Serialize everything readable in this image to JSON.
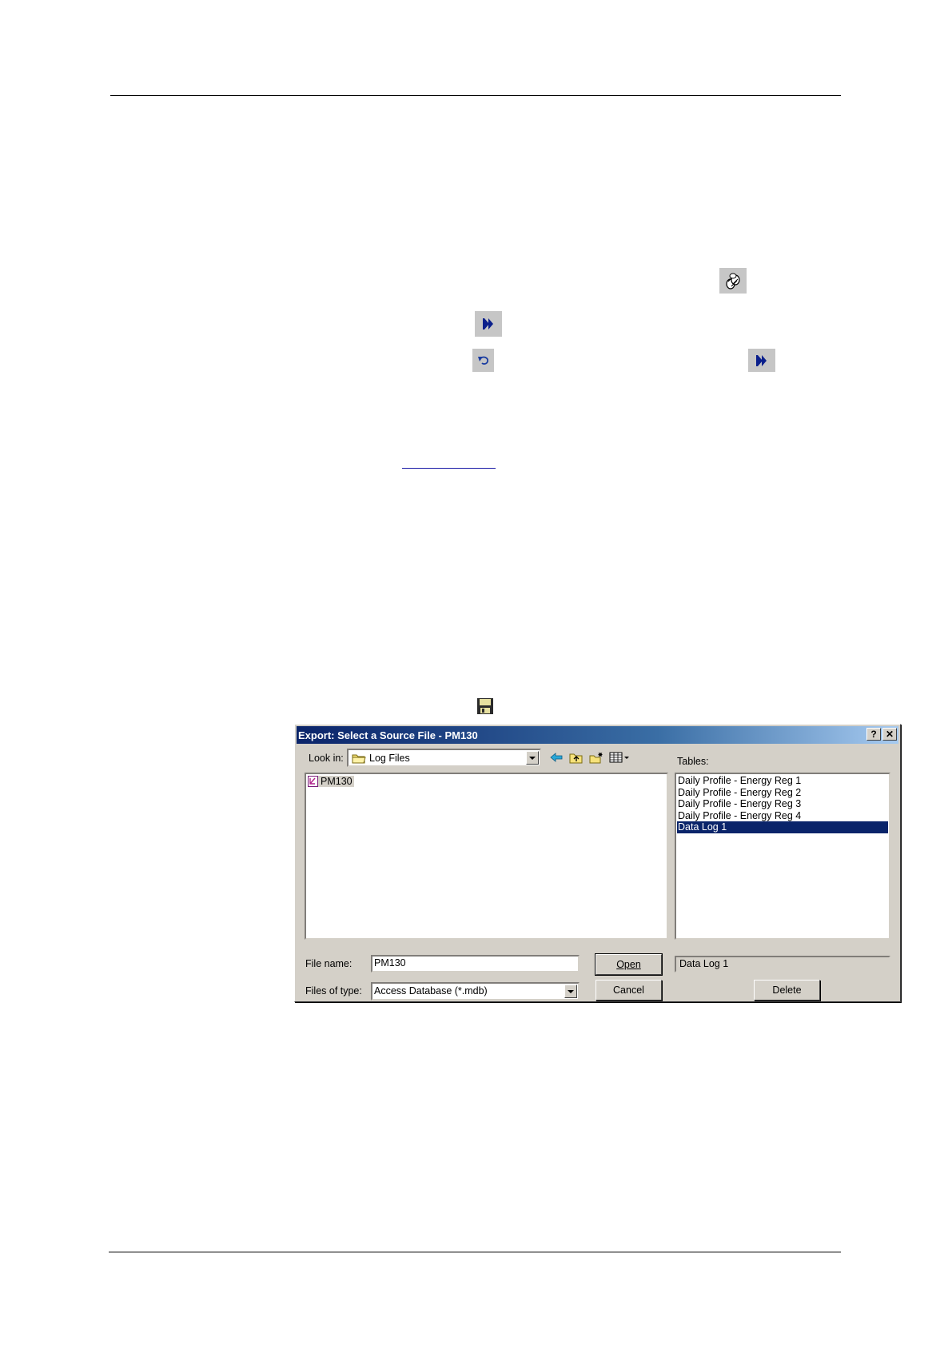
{
  "toolbar_icons": [
    "open-cylinders-icon",
    "forward-icon",
    "undo-icon",
    "forward-icon",
    "save-disk-icon"
  ],
  "dialog": {
    "title": "Export: Select a Source File - PM130",
    "help_button": "?",
    "close_button": "✕",
    "look_in_label": "Look in:",
    "look_in_value": "Log Files",
    "tables_label": "Tables:",
    "files": [
      {
        "name": "PM130",
        "icon": "database-file-icon"
      }
    ],
    "tables": [
      {
        "label": "Daily Profile - Energy Reg 1",
        "selected": false
      },
      {
        "label": "Daily Profile - Energy Reg 2",
        "selected": false
      },
      {
        "label": "Daily Profile - Energy Reg 3",
        "selected": false
      },
      {
        "label": "Daily Profile - Energy Reg 4",
        "selected": false
      },
      {
        "label": "Data Log 1",
        "selected": true
      }
    ],
    "selected_table": "Data Log 1",
    "file_name_label": "File name:",
    "file_name_value": "PM130",
    "files_of_type_label": "Files of type:",
    "files_of_type_value": "Access Database (*.mdb)",
    "open_button": "Open",
    "cancel_button": "Cancel",
    "delete_button": "Delete",
    "colors": {
      "titlebar": "#0a246a",
      "selection": "#0a246a",
      "face": "#d4d0c8"
    }
  }
}
